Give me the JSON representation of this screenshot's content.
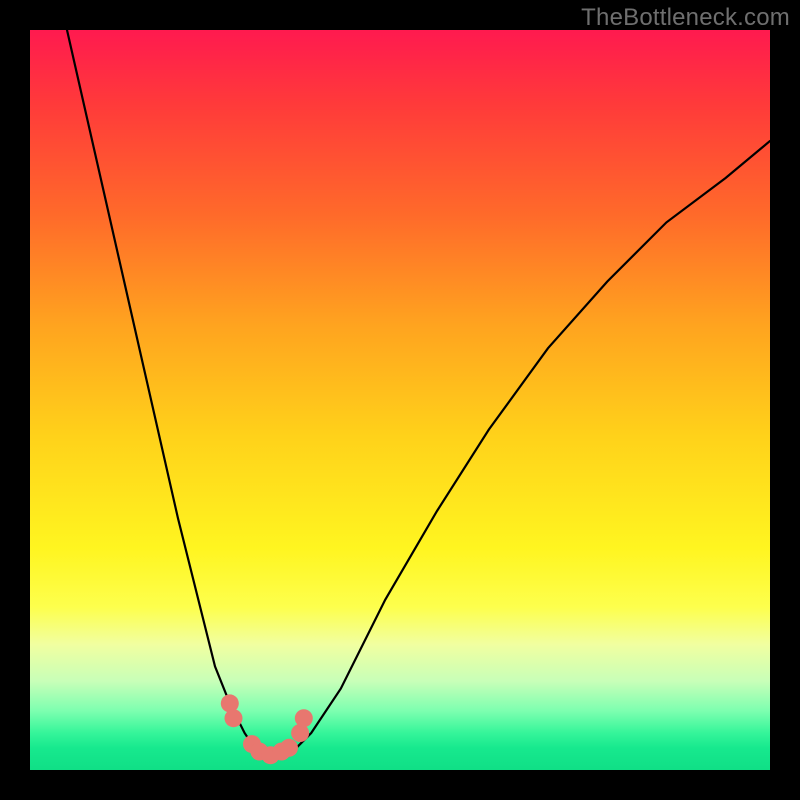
{
  "watermark": "TheBottleneck.com",
  "colors": {
    "frame": "#000000",
    "curve": "#000000",
    "dots": "#e8776f"
  },
  "chart_data": {
    "type": "line",
    "title": "",
    "xlabel": "",
    "ylabel": "",
    "xlim": [
      0,
      100
    ],
    "ylim": [
      0,
      100
    ],
    "grid": false,
    "legend": false,
    "series": [
      {
        "name": "curve",
        "x": [
          5,
          10,
          15,
          20,
          25,
          27,
          29,
          30,
          31,
          32,
          33,
          34,
          35,
          36,
          38,
          42,
          48,
          55,
          62,
          70,
          78,
          86,
          94,
          100
        ],
        "y": [
          100,
          78,
          56,
          34,
          14,
          9,
          5,
          3.5,
          2.5,
          2,
          2,
          2,
          2.5,
          3,
          5,
          11,
          23,
          35,
          46,
          57,
          66,
          74,
          80,
          85
        ]
      }
    ],
    "markers": [
      {
        "x": 27,
        "y": 9
      },
      {
        "x": 27.5,
        "y": 7
      },
      {
        "x": 30,
        "y": 3.5
      },
      {
        "x": 31,
        "y": 2.5
      },
      {
        "x": 32.5,
        "y": 2
      },
      {
        "x": 34,
        "y": 2.5
      },
      {
        "x": 35,
        "y": 3
      },
      {
        "x": 36.5,
        "y": 5
      },
      {
        "x": 37,
        "y": 7
      }
    ]
  }
}
